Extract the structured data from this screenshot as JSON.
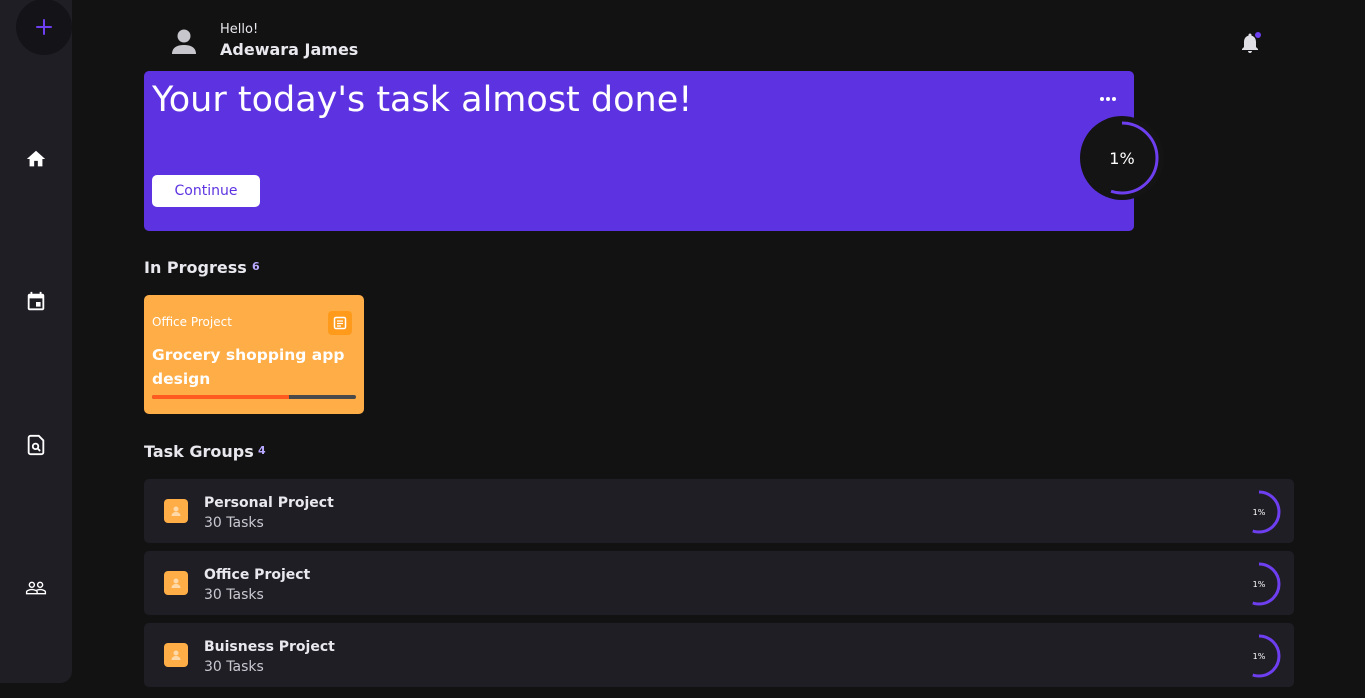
{
  "header": {
    "greeting": "Hello!",
    "user_name": "Adewara James"
  },
  "sidebar": {
    "add_icon": "plus-icon",
    "items": [
      {
        "icon": "home-icon"
      },
      {
        "icon": "calendar-icon"
      },
      {
        "icon": "document-search-icon"
      },
      {
        "icon": "people-icon"
      }
    ]
  },
  "hero": {
    "title": "Your today's task almost done!",
    "continue_label": "Continue",
    "progress_label": "1%",
    "progress_fraction": 0.55,
    "menu_icon": "more-horizontal-icon"
  },
  "in_progress": {
    "title": "In Progress",
    "count": "6",
    "cards": [
      {
        "category": "Office Project",
        "title": "Grocery shopping app design",
        "progress_fraction": 0.67,
        "icon": "note-icon"
      }
    ]
  },
  "task_groups": {
    "title": "Task Groups",
    "count": "4",
    "items": [
      {
        "name": "Personal Project",
        "tasks": "30 Tasks",
        "progress_label": "1%",
        "progress_fraction": 0.55
      },
      {
        "name": "Office Project",
        "tasks": "30 Tasks",
        "progress_label": "1%",
        "progress_fraction": 0.55
      },
      {
        "name": "Buisness Project",
        "tasks": "30 Tasks",
        "progress_label": "1%",
        "progress_fraction": 0.55
      }
    ]
  },
  "colors": {
    "background": "#121212",
    "sidebar": "#1f1e25",
    "accent_purple": "#5d33e1",
    "ring_purple": "#6e3ff0",
    "card_orange": "#ffad47",
    "progress_orange": "#ff5a1f"
  }
}
